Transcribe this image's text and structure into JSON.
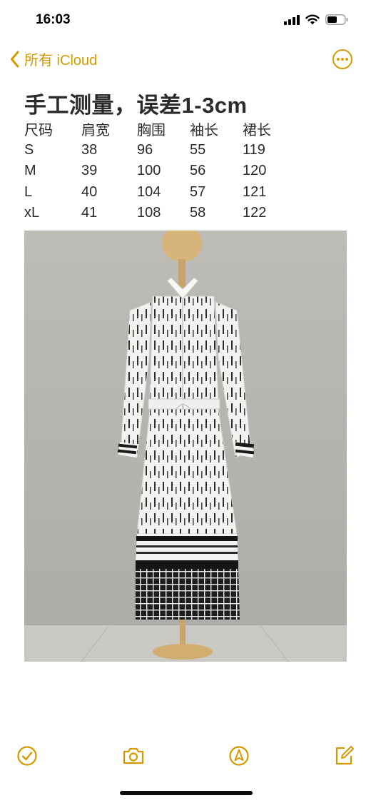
{
  "status_bar": {
    "time": "16:03",
    "icons": [
      "cellular-signal-icon",
      "wifi-icon",
      "battery-icon"
    ]
  },
  "nav": {
    "back_label": "所有 iCloud",
    "back_icon": "chevron-left-icon",
    "more_icon": "more-ellipsis-icon",
    "accent_color": "#d29c00"
  },
  "note": {
    "title": "手工测量，误差1-3cm",
    "table": {
      "headers": [
        "尺码",
        "肩宽",
        "胸围",
        "袖长",
        "裙长"
      ],
      "rows": [
        [
          "S",
          "38",
          "96",
          "55",
          "119"
        ],
        [
          "M",
          "39",
          "100",
          "56",
          "120"
        ],
        [
          "L",
          "40",
          "104",
          "57",
          "121"
        ],
        [
          "xL",
          "41",
          "108",
          "58",
          "122"
        ]
      ]
    }
  },
  "photo": {
    "subject": "dress-on-mannequin-photo"
  },
  "toolbar": {
    "tools": [
      "checklist-icon",
      "camera-icon",
      "markup-pen-icon",
      "compose-icon"
    ]
  }
}
